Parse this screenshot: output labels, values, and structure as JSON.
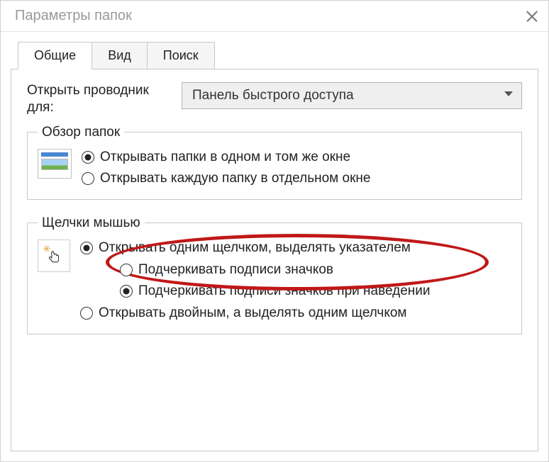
{
  "window": {
    "title": "Параметры папок"
  },
  "tabs": [
    {
      "label": "Общие",
      "active": true
    },
    {
      "label": "Вид",
      "active": false
    },
    {
      "label": "Поиск",
      "active": false
    }
  ],
  "open_explorer": {
    "label": "Открыть проводник для:",
    "value": "Панель быстрого доступа"
  },
  "folder_browse": {
    "legend": "Обзор папок",
    "options": [
      {
        "label": "Открывать папки в одном и том же окне",
        "checked": true
      },
      {
        "label": "Открывать каждую папку в отдельном окне",
        "checked": false
      }
    ]
  },
  "mouse_clicks": {
    "legend": "Щелчки мышью",
    "options": [
      {
        "label": "Открывать одним щелчком, выделять указателем",
        "checked": true,
        "sub": false
      },
      {
        "label": "Подчеркивать подписи значков",
        "checked": false,
        "sub": true
      },
      {
        "label": "Подчеркивать подписи значков при наведении",
        "checked": true,
        "sub": true
      },
      {
        "label": "Открывать двойным, а выделять одним щелчком",
        "checked": false,
        "sub": false
      }
    ]
  }
}
